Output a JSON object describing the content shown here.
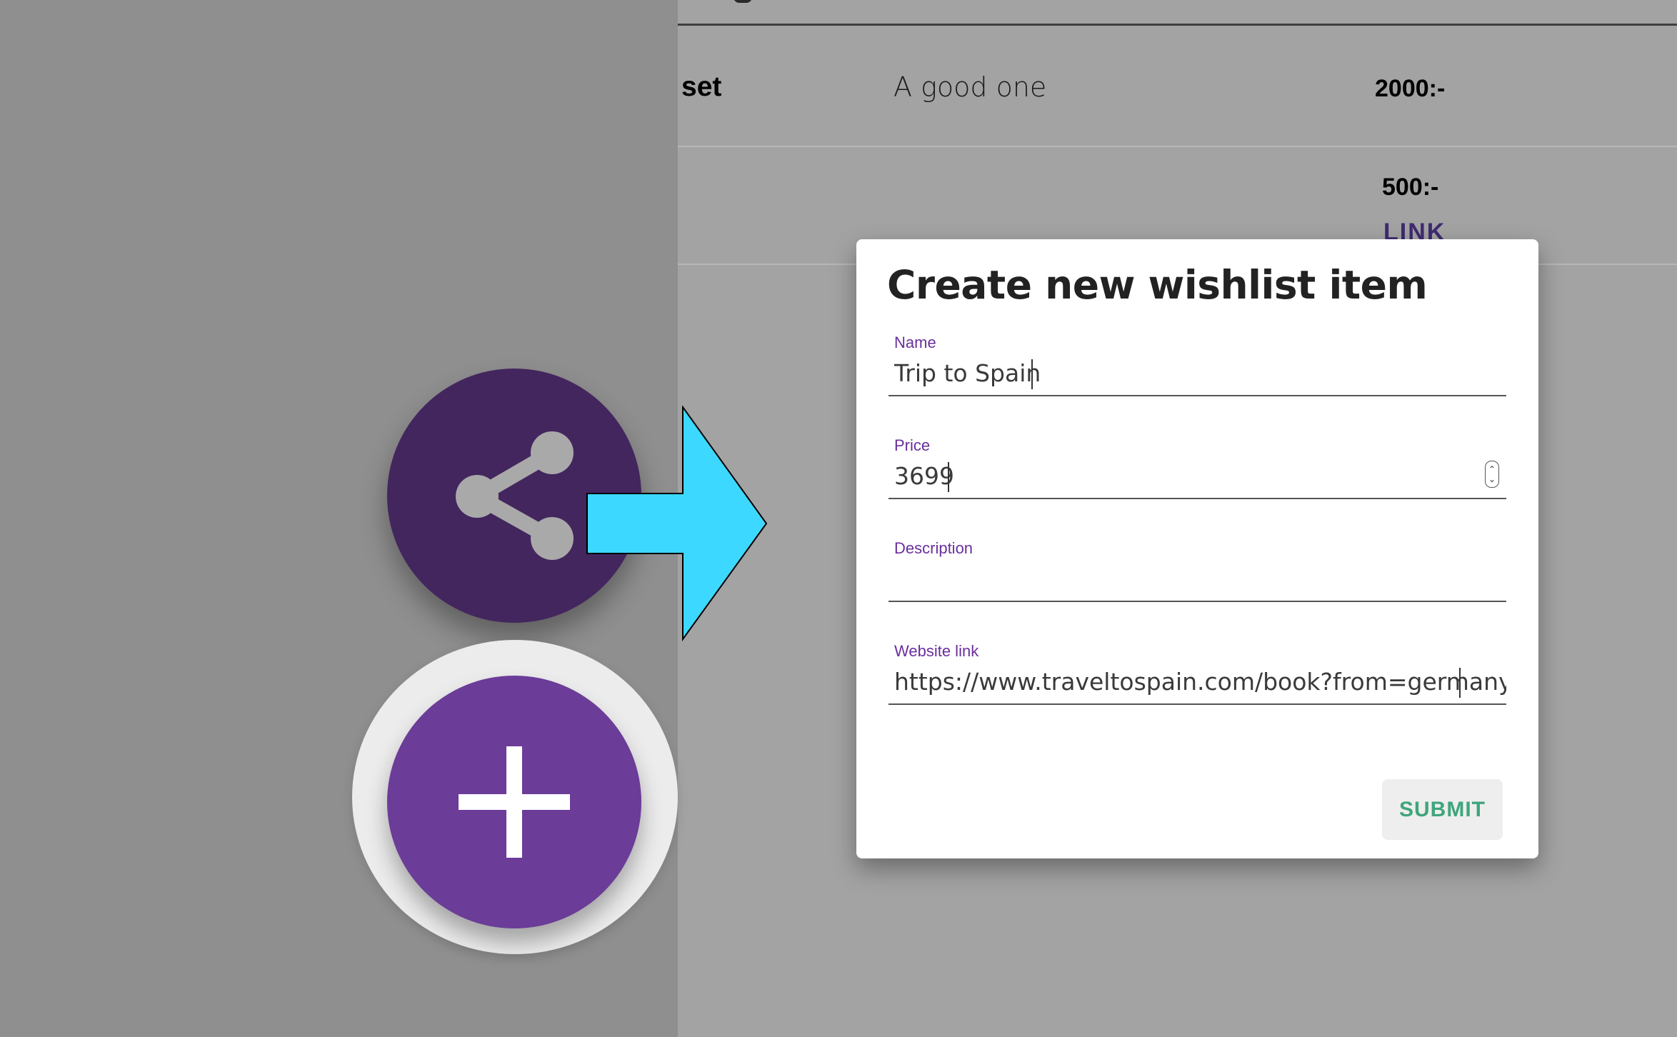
{
  "background_table": {
    "rows": [
      {
        "name": "set",
        "description": "A good one",
        "price": "2000:-"
      },
      {
        "name": "",
        "description": "",
        "price": "500:-",
        "link_label": "LINK"
      }
    ]
  },
  "fabs": {
    "share_icon": "share-icon",
    "add_icon": "plus-icon"
  },
  "dialog": {
    "title": "Create new wishlist item",
    "fields": {
      "name": {
        "label": "Name",
        "value": "Trip to Spain"
      },
      "price": {
        "label": "Price",
        "value": "3699"
      },
      "description": {
        "label": "Description",
        "value": ""
      },
      "website_link": {
        "label": "Website link",
        "value": "https://www.traveltospain.com/book?from=germany"
      }
    },
    "submit_label": "SUBMIT"
  },
  "colors": {
    "primary": "#6b3c98",
    "primary_dark": "#43265e",
    "accent_submit": "#3fa57c",
    "highlight_arrow": "#3dd8ff"
  }
}
